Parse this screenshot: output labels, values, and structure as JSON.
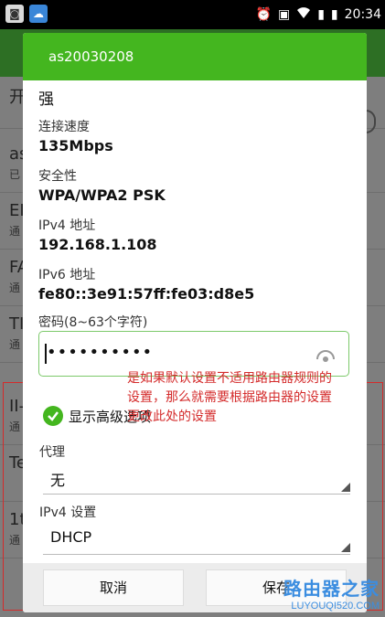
{
  "status_bar": {
    "time": "20:34",
    "icons": [
      "screenshot-app-icon",
      "cloud-app-icon",
      "alarm-icon",
      "notification-icon",
      "wifi-icon",
      "signal-icon",
      "battery-icon"
    ]
  },
  "background": {
    "toggle_label": "开",
    "rows": [
      {
        "title": "as",
        "sub": "已"
      },
      {
        "title": "EI",
        "sub": "通"
      },
      {
        "title": "FA",
        "sub": "通"
      },
      {
        "title": "TI",
        "sub": "通"
      },
      {
        "title": "II-",
        "sub": "通"
      },
      {
        "title": "Te",
        "sub": ""
      },
      {
        "title": "1t",
        "sub": "通"
      }
    ]
  },
  "dialog": {
    "title": "as20030208",
    "signal_strength": "强",
    "link_speed_label": "连接速度",
    "link_speed_value": "135Mbps",
    "security_label": "安全性",
    "security_value": "WPA/WPA2 PSK",
    "ipv4_label": "IPv4 地址",
    "ipv4_value": "192.168.1.108",
    "ipv6_label": "IPv6 地址",
    "ipv6_value": "fe80::3e91:57ff:fe03:d8e5",
    "password_label": "密码(8~63个字符)",
    "password_value": "••••••••••",
    "advanced_label": "显示高级选项",
    "advanced_checked": true,
    "proxy_label": "代理",
    "proxy_value": "无",
    "ipv4_settings_label": "IPv4 设置",
    "ipv4_settings_value": "DHCP",
    "cancel_label": "取消",
    "save_label": "保存"
  },
  "annotation": "是如果默认设置不适用路由器规则的设置，那么就需要根据路由器的设置更改此处的设置",
  "watermark": {
    "line1": "路由器之家",
    "line2": "LUYOUQI520.COM"
  },
  "colors": {
    "accent": "#44b61f",
    "annotation": "#d42b2b",
    "watermark": "#3b8de0"
  }
}
